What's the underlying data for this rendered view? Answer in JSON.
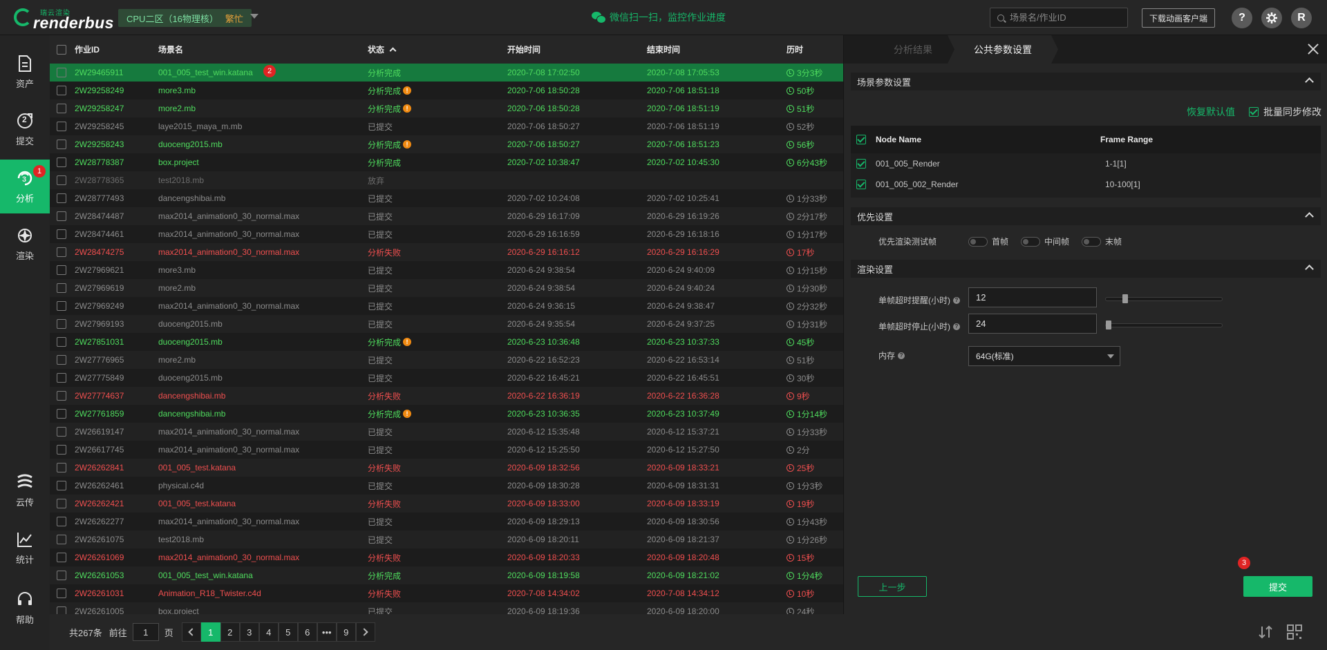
{
  "topbar": {
    "logo_small": "瑞云渲染",
    "logo_text": "renderbus",
    "cpu_zone": "CPU二区（16物理核）",
    "cpu_status": "繁忙",
    "wechat_text": "微信扫一扫，监控作业进度",
    "search_placeholder": "场景名/作业ID",
    "download_button": "下载动画客户端",
    "help_label": "?",
    "user_initial": "R",
    "icons": [
      "wechat-icon",
      "search-icon",
      "help-icon",
      "gear-icon",
      "avatar"
    ]
  },
  "sidebar": {
    "items": [
      {
        "label": "资产",
        "icon": "file-icon"
      },
      {
        "label": "提交",
        "icon": "submit-icon",
        "step": "2"
      },
      {
        "label": "分析",
        "icon": "analyze-icon",
        "step": "3",
        "badge": "1",
        "active": true
      },
      {
        "label": "渲染",
        "icon": "render-icon"
      },
      {
        "label": "云传",
        "icon": "cloud-transfer-icon"
      },
      {
        "label": "统计",
        "icon": "stats-icon"
      },
      {
        "label": "帮助",
        "icon": "headset-icon"
      }
    ]
  },
  "table": {
    "headers": {
      "id": "作业ID",
      "scene": "场景名",
      "status": "状态",
      "start": "开始时间",
      "end": "结束时间",
      "duration": "历时"
    },
    "rows": [
      {
        "id": "2W29465911",
        "scene": "001_005_test_win.katana",
        "status": "分析完成",
        "start": "2020-7-08 17:02:50",
        "end": "2020-7-08 17:05:53",
        "duration": "3分3秒",
        "tone": "green",
        "warn": false,
        "selected": true,
        "badge": "2"
      },
      {
        "id": "2W29258249",
        "scene": "more3.mb",
        "status": "分析完成",
        "start": "2020-7-06 18:50:28",
        "end": "2020-7-06 18:51:18",
        "duration": "50秒",
        "tone": "green",
        "warn": true
      },
      {
        "id": "2W29258247",
        "scene": "more2.mb",
        "status": "分析完成",
        "start": "2020-7-06 18:50:28",
        "end": "2020-7-06 18:51:19",
        "duration": "51秒",
        "tone": "green",
        "warn": true
      },
      {
        "id": "2W29258245",
        "scene": "laye2015_maya_m.mb",
        "status": "已提交",
        "start": "2020-7-06 18:50:27",
        "end": "2020-7-06 18:51:19",
        "duration": "52秒",
        "tone": "gray",
        "warn": false
      },
      {
        "id": "2W29258243",
        "scene": "duoceng2015.mb",
        "status": "分析完成",
        "start": "2020-7-06 18:50:27",
        "end": "2020-7-06 18:51:23",
        "duration": "56秒",
        "tone": "green",
        "warn": true
      },
      {
        "id": "2W28778387",
        "scene": "box.project",
        "status": "分析完成",
        "start": "2020-7-02 10:38:47",
        "end": "2020-7-02 10:45:30",
        "duration": "6分43秒",
        "tone": "green",
        "warn": false
      },
      {
        "id": "2W28778365",
        "scene": "test2018.mb",
        "status": "放弃",
        "start": "",
        "end": "",
        "duration": "",
        "tone": "dim",
        "warn": false
      },
      {
        "id": "2W28777493",
        "scene": "dancengshibai.mb",
        "status": "已提交",
        "start": "2020-7-02 10:24:08",
        "end": "2020-7-02 10:25:41",
        "duration": "1分33秒",
        "tone": "gray",
        "warn": false
      },
      {
        "id": "2W28474487",
        "scene": "max2014_animation0_30_normal.max",
        "status": "已提交",
        "start": "2020-6-29 16:17:09",
        "end": "2020-6-29 16:19:26",
        "duration": "2分17秒",
        "tone": "gray",
        "warn": false
      },
      {
        "id": "2W28474461",
        "scene": "max2014_animation0_30_normal.max",
        "status": "已提交",
        "start": "2020-6-29 16:16:59",
        "end": "2020-6-29 16:18:16",
        "duration": "1分17秒",
        "tone": "gray",
        "warn": false
      },
      {
        "id": "2W28474275",
        "scene": "max2014_animation0_30_normal.max",
        "status": "分析失败",
        "start": "2020-6-29 16:16:12",
        "end": "2020-6-29 16:16:29",
        "duration": "17秒",
        "tone": "red",
        "warn": false
      },
      {
        "id": "2W27969621",
        "scene": "more3.mb",
        "status": "已提交",
        "start": "2020-6-24 9:38:54",
        "end": "2020-6-24 9:40:09",
        "duration": "1分15秒",
        "tone": "gray",
        "warn": false
      },
      {
        "id": "2W27969619",
        "scene": "more2.mb",
        "status": "已提交",
        "start": "2020-6-24 9:38:54",
        "end": "2020-6-24 9:40:24",
        "duration": "1分30秒",
        "tone": "gray",
        "warn": false
      },
      {
        "id": "2W27969249",
        "scene": "max2014_animation0_30_normal.max",
        "status": "已提交",
        "start": "2020-6-24 9:36:15",
        "end": "2020-6-24 9:38:47",
        "duration": "2分32秒",
        "tone": "gray",
        "warn": false
      },
      {
        "id": "2W27969193",
        "scene": "duoceng2015.mb",
        "status": "已提交",
        "start": "2020-6-24 9:35:54",
        "end": "2020-6-24 9:37:25",
        "duration": "1分31秒",
        "tone": "gray",
        "warn": false
      },
      {
        "id": "2W27851031",
        "scene": "duoceng2015.mb",
        "status": "分析完成",
        "start": "2020-6-23 10:36:48",
        "end": "2020-6-23 10:37:33",
        "duration": "45秒",
        "tone": "green",
        "warn": true
      },
      {
        "id": "2W27776965",
        "scene": "more2.mb",
        "status": "已提交",
        "start": "2020-6-22 16:52:23",
        "end": "2020-6-22 16:53:14",
        "duration": "51秒",
        "tone": "gray",
        "warn": false
      },
      {
        "id": "2W27775849",
        "scene": "duoceng2015.mb",
        "status": "已提交",
        "start": "2020-6-22 16:45:21",
        "end": "2020-6-22 16:45:51",
        "duration": "30秒",
        "tone": "gray",
        "warn": false
      },
      {
        "id": "2W27774637",
        "scene": "dancengshibai.mb",
        "status": "分析失败",
        "start": "2020-6-22 16:36:19",
        "end": "2020-6-22 16:36:28",
        "duration": "9秒",
        "tone": "red",
        "warn": false
      },
      {
        "id": "2W27761859",
        "scene": "dancengshibai.mb",
        "status": "分析完成",
        "start": "2020-6-23 10:36:35",
        "end": "2020-6-23 10:37:49",
        "duration": "1分14秒",
        "tone": "green",
        "warn": true
      },
      {
        "id": "2W26619147",
        "scene": "max2014_animation0_30_normal.max",
        "status": "已提交",
        "start": "2020-6-12 15:35:48",
        "end": "2020-6-12 15:37:21",
        "duration": "1分33秒",
        "tone": "gray",
        "warn": false
      },
      {
        "id": "2W26617745",
        "scene": "max2014_animation0_30_normal.max",
        "status": "已提交",
        "start": "2020-6-12 15:25:50",
        "end": "2020-6-12 15:27:50",
        "duration": "2分",
        "tone": "gray",
        "warn": false
      },
      {
        "id": "2W26262841",
        "scene": "001_005_test.katana",
        "status": "分析失败",
        "start": "2020-6-09 18:32:56",
        "end": "2020-6-09 18:33:21",
        "duration": "25秒",
        "tone": "red",
        "warn": false
      },
      {
        "id": "2W26262461",
        "scene": "physical.c4d",
        "status": "已提交",
        "start": "2020-6-09 18:30:28",
        "end": "2020-6-09 18:31:31",
        "duration": "1分3秒",
        "tone": "gray",
        "warn": false
      },
      {
        "id": "2W26262421",
        "scene": "001_005_test.katana",
        "status": "分析失败",
        "start": "2020-6-09 18:33:00",
        "end": "2020-6-09 18:33:19",
        "duration": "19秒",
        "tone": "red",
        "warn": false
      },
      {
        "id": "2W26262277",
        "scene": "max2014_animation0_30_normal.max",
        "status": "已提交",
        "start": "2020-6-09 18:29:13",
        "end": "2020-6-09 18:30:56",
        "duration": "1分43秒",
        "tone": "gray",
        "warn": false
      },
      {
        "id": "2W26261075",
        "scene": "test2018.mb",
        "status": "已提交",
        "start": "2020-6-09 18:20:11",
        "end": "2020-6-09 18:21:37",
        "duration": "1分26秒",
        "tone": "gray",
        "warn": false
      },
      {
        "id": "2W26261069",
        "scene": "max2014_animation0_30_normal.max",
        "status": "分析失败",
        "start": "2020-6-09 18:20:33",
        "end": "2020-6-09 18:20:48",
        "duration": "15秒",
        "tone": "red",
        "warn": false
      },
      {
        "id": "2W26261053",
        "scene": "001_005_test_win.katana",
        "status": "分析完成",
        "start": "2020-6-09 18:19:58",
        "end": "2020-6-09 18:21:02",
        "duration": "1分4秒",
        "tone": "green",
        "warn": false
      },
      {
        "id": "2W26261031",
        "scene": "Animation_R18_Twister.c4d",
        "status": "分析失败",
        "start": "2020-7-08 14:34:02",
        "end": "2020-7-08 14:34:12",
        "duration": "10秒",
        "tone": "red",
        "warn": false
      },
      {
        "id": "2W26261005",
        "scene": "box.project",
        "status": "已提交",
        "start": "2020-6-09 18:19:36",
        "end": "2020-6-09 18:20:00",
        "duration": "24秒",
        "tone": "gray",
        "warn": false
      }
    ]
  },
  "pager": {
    "total": "共267条",
    "goto_label": "前往",
    "goto_value": "1",
    "page_unit": "页",
    "pages": [
      "1",
      "2",
      "3",
      "4",
      "5",
      "6",
      "•••",
      "9"
    ],
    "current": "1"
  },
  "panel": {
    "tab_inactive": "分析结果",
    "tab_active": "公共参数设置",
    "scene_section": "场景参数设置",
    "restore_default": "恢复默认值",
    "batch_sync": "批量同步修改",
    "node_headers": {
      "name": "Node Name",
      "range": "Frame Range"
    },
    "nodes": [
      {
        "name": "001_005_Render",
        "range": "1-1[1]"
      },
      {
        "name": "001_005_002_Render",
        "range": "10-100[1]"
      }
    ],
    "priority_section": "优先设置",
    "priority_label": "优先渲染测试帧",
    "priority_options": [
      "首帧",
      "中间帧",
      "末帧"
    ],
    "render_section": "渲染设置",
    "timeout_warn_label": "单帧超时提醒(小时)",
    "timeout_warn_value": "12",
    "timeout_stop_label": "单帧超时停止(小时)",
    "timeout_stop_value": "24",
    "memory_label": "内存",
    "memory_value": "64G(标准)",
    "prev_button": "上一步",
    "submit_button": "提交",
    "submit_badge": "3"
  },
  "colors": {
    "accent": "#16b86a",
    "done": "#4fdc5e",
    "failed": "#f04f4f",
    "submitted": "#8c8c8c",
    "warn": "#f08a12",
    "badge": "#e02424"
  }
}
